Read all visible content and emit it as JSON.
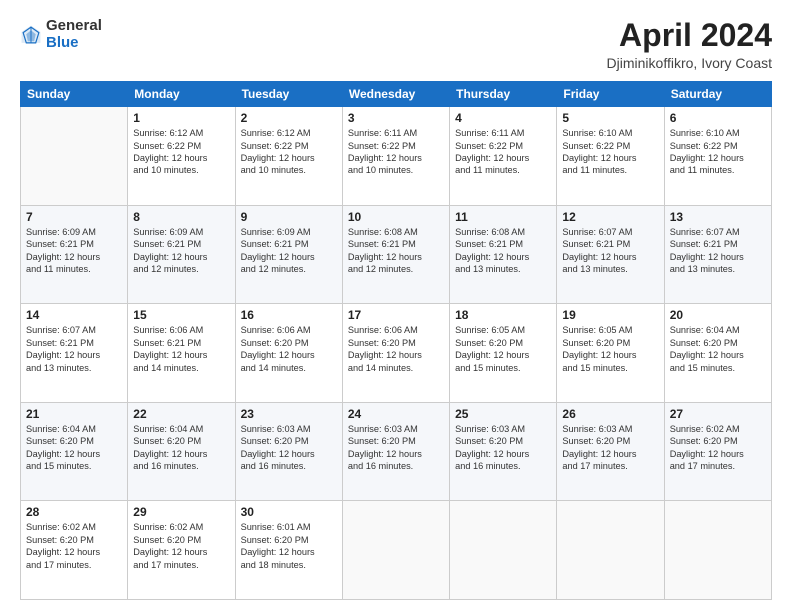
{
  "logo": {
    "general": "General",
    "blue": "Blue"
  },
  "header": {
    "month": "April 2024",
    "location": "Djiminikoffikro, Ivory Coast"
  },
  "weekdays": [
    "Sunday",
    "Monday",
    "Tuesday",
    "Wednesday",
    "Thursday",
    "Friday",
    "Saturday"
  ],
  "weeks": [
    [
      {
        "day": "",
        "info": ""
      },
      {
        "day": "1",
        "info": "Sunrise: 6:12 AM\nSunset: 6:22 PM\nDaylight: 12 hours\nand 10 minutes."
      },
      {
        "day": "2",
        "info": "Sunrise: 6:12 AM\nSunset: 6:22 PM\nDaylight: 12 hours\nand 10 minutes."
      },
      {
        "day": "3",
        "info": "Sunrise: 6:11 AM\nSunset: 6:22 PM\nDaylight: 12 hours\nand 10 minutes."
      },
      {
        "day": "4",
        "info": "Sunrise: 6:11 AM\nSunset: 6:22 PM\nDaylight: 12 hours\nand 11 minutes."
      },
      {
        "day": "5",
        "info": "Sunrise: 6:10 AM\nSunset: 6:22 PM\nDaylight: 12 hours\nand 11 minutes."
      },
      {
        "day": "6",
        "info": "Sunrise: 6:10 AM\nSunset: 6:22 PM\nDaylight: 12 hours\nand 11 minutes."
      }
    ],
    [
      {
        "day": "7",
        "info": "Sunrise: 6:09 AM\nSunset: 6:21 PM\nDaylight: 12 hours\nand 11 minutes."
      },
      {
        "day": "8",
        "info": "Sunrise: 6:09 AM\nSunset: 6:21 PM\nDaylight: 12 hours\nand 12 minutes."
      },
      {
        "day": "9",
        "info": "Sunrise: 6:09 AM\nSunset: 6:21 PM\nDaylight: 12 hours\nand 12 minutes."
      },
      {
        "day": "10",
        "info": "Sunrise: 6:08 AM\nSunset: 6:21 PM\nDaylight: 12 hours\nand 12 minutes."
      },
      {
        "day": "11",
        "info": "Sunrise: 6:08 AM\nSunset: 6:21 PM\nDaylight: 12 hours\nand 13 minutes."
      },
      {
        "day": "12",
        "info": "Sunrise: 6:07 AM\nSunset: 6:21 PM\nDaylight: 12 hours\nand 13 minutes."
      },
      {
        "day": "13",
        "info": "Sunrise: 6:07 AM\nSunset: 6:21 PM\nDaylight: 12 hours\nand 13 minutes."
      }
    ],
    [
      {
        "day": "14",
        "info": "Sunrise: 6:07 AM\nSunset: 6:21 PM\nDaylight: 12 hours\nand 13 minutes."
      },
      {
        "day": "15",
        "info": "Sunrise: 6:06 AM\nSunset: 6:21 PM\nDaylight: 12 hours\nand 14 minutes."
      },
      {
        "day": "16",
        "info": "Sunrise: 6:06 AM\nSunset: 6:20 PM\nDaylight: 12 hours\nand 14 minutes."
      },
      {
        "day": "17",
        "info": "Sunrise: 6:06 AM\nSunset: 6:20 PM\nDaylight: 12 hours\nand 14 minutes."
      },
      {
        "day": "18",
        "info": "Sunrise: 6:05 AM\nSunset: 6:20 PM\nDaylight: 12 hours\nand 15 minutes."
      },
      {
        "day": "19",
        "info": "Sunrise: 6:05 AM\nSunset: 6:20 PM\nDaylight: 12 hours\nand 15 minutes."
      },
      {
        "day": "20",
        "info": "Sunrise: 6:04 AM\nSunset: 6:20 PM\nDaylight: 12 hours\nand 15 minutes."
      }
    ],
    [
      {
        "day": "21",
        "info": "Sunrise: 6:04 AM\nSunset: 6:20 PM\nDaylight: 12 hours\nand 15 minutes."
      },
      {
        "day": "22",
        "info": "Sunrise: 6:04 AM\nSunset: 6:20 PM\nDaylight: 12 hours\nand 16 minutes."
      },
      {
        "day": "23",
        "info": "Sunrise: 6:03 AM\nSunset: 6:20 PM\nDaylight: 12 hours\nand 16 minutes."
      },
      {
        "day": "24",
        "info": "Sunrise: 6:03 AM\nSunset: 6:20 PM\nDaylight: 12 hours\nand 16 minutes."
      },
      {
        "day": "25",
        "info": "Sunrise: 6:03 AM\nSunset: 6:20 PM\nDaylight: 12 hours\nand 16 minutes."
      },
      {
        "day": "26",
        "info": "Sunrise: 6:03 AM\nSunset: 6:20 PM\nDaylight: 12 hours\nand 17 minutes."
      },
      {
        "day": "27",
        "info": "Sunrise: 6:02 AM\nSunset: 6:20 PM\nDaylight: 12 hours\nand 17 minutes."
      }
    ],
    [
      {
        "day": "28",
        "info": "Sunrise: 6:02 AM\nSunset: 6:20 PM\nDaylight: 12 hours\nand 17 minutes."
      },
      {
        "day": "29",
        "info": "Sunrise: 6:02 AM\nSunset: 6:20 PM\nDaylight: 12 hours\nand 17 minutes."
      },
      {
        "day": "30",
        "info": "Sunrise: 6:01 AM\nSunset: 6:20 PM\nDaylight: 12 hours\nand 18 minutes."
      },
      {
        "day": "",
        "info": ""
      },
      {
        "day": "",
        "info": ""
      },
      {
        "day": "",
        "info": ""
      },
      {
        "day": "",
        "info": ""
      }
    ]
  ]
}
